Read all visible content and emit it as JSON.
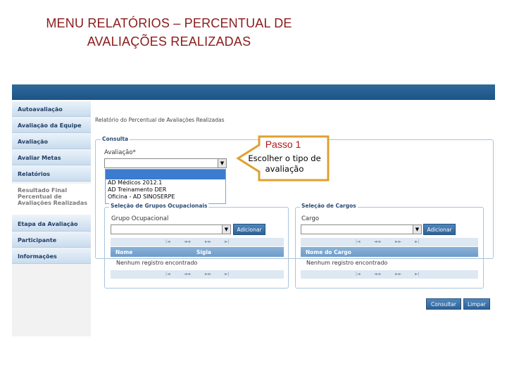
{
  "slide": {
    "title_line1": "MENU RELATÓRIOS – PERCENTUAL DE",
    "title_line2": "AVALIAÇÕES REALIZADAS"
  },
  "sidebar": {
    "items": [
      {
        "label": "Autoavaliação"
      },
      {
        "label": "Avaliação da Equipe"
      },
      {
        "label": "Avaliação"
      },
      {
        "label": "Avaliar Metas"
      },
      {
        "label": "Relatórios"
      },
      {
        "label": "Etapa da Avaliação"
      },
      {
        "label": "Participante"
      },
      {
        "label": "Informações"
      }
    ],
    "active": {
      "line1": "Resultado Final",
      "line2": "Percentual de",
      "line3": "Avaliações Realizadas"
    }
  },
  "main": {
    "page_title": "Relatório do Percentual de Avaliações Realizadas",
    "consulta_legend": "Consulta",
    "avaliacao_label": "Avaliação*",
    "avaliacao_options": [
      "AD Médicos 2012.1",
      "AD Treinamento DER",
      "Oficina - AD SINOSERPE"
    ],
    "grupos": {
      "legend": "Seleção de Grupos Ocupacionais",
      "field_label": "Grupo Ocupacional",
      "add_button": "Adicionar",
      "col_nome": "Nome",
      "col_sigla": "Sigla",
      "empty": "Nenhum registro encontrado"
    },
    "cargos": {
      "legend": "Seleção de Cargos",
      "field_label": "Cargo",
      "add_button": "Adicionar",
      "col_nome": "Nome do Cargo",
      "empty": "Nenhum registro encontrado"
    },
    "pager": {
      "first": "|◄",
      "prev": "◄◄",
      "next": "►►",
      "last": "►|"
    },
    "consultar_button": "Consultar",
    "limpar_button": "Limpar"
  },
  "callout": {
    "title": "Passo 1",
    "text": "Escolher o tipo de avaliação"
  },
  "colors": {
    "title": "#8b1a1a",
    "accent": "#2d6297",
    "callout_border": "#e0a030",
    "callout_title": "#b01818"
  }
}
